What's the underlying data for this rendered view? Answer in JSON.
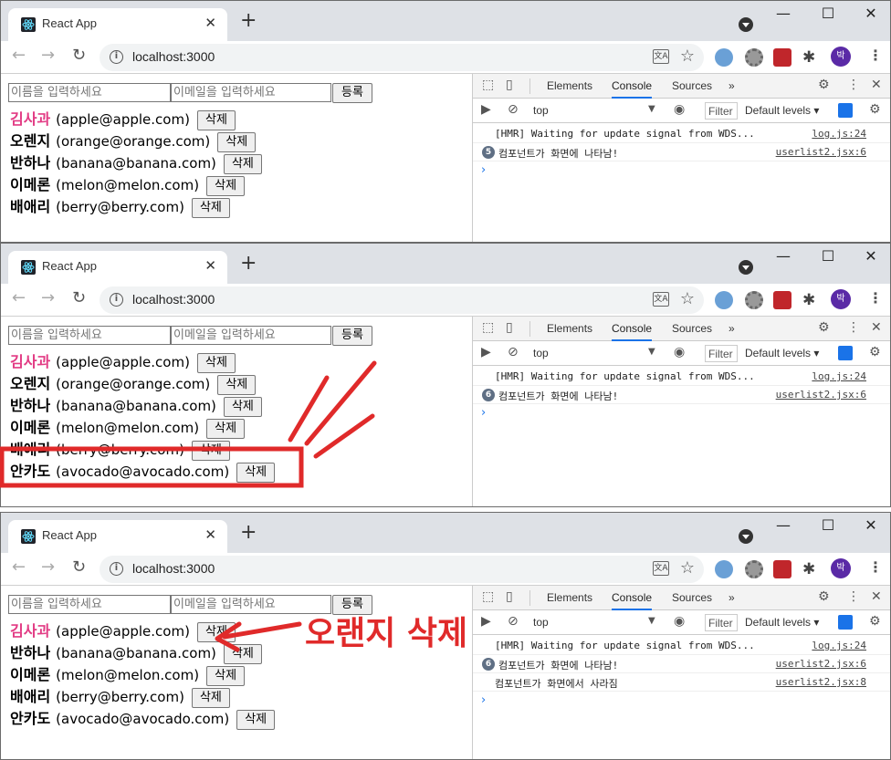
{
  "browser": {
    "tab_title": "React App",
    "tab_close": "✕",
    "new_tab": "+",
    "minimize": "—",
    "maximize": "☐",
    "close": "✕",
    "url": "localhost:3000",
    "translate_icon": "文A",
    "avatar": "박"
  },
  "form": {
    "name_placeholder": "이름을 입력하세요",
    "email_placeholder": "이메일을 입력하세요",
    "register_label": "등록"
  },
  "delete_label": "삭제",
  "panels": [
    {
      "users": [
        {
          "name": "김사과",
          "email": "(apple@apple.com)",
          "active": true
        },
        {
          "name": "오렌지",
          "email": "(orange@orange.com)",
          "active": false
        },
        {
          "name": "반하나",
          "email": "(banana@banana.com)",
          "active": false
        },
        {
          "name": "이메론",
          "email": "(melon@melon.com)",
          "active": false
        },
        {
          "name": "배애리",
          "email": "(berry@berry.com)",
          "active": false
        }
      ],
      "console": [
        {
          "count": "",
          "text": "[HMR] Waiting for update signal from WDS...",
          "source": "log.js:24"
        },
        {
          "count": "5",
          "text": "컴포넌트가 화면에 나타남!",
          "source": "userlist2.jsx:6"
        }
      ]
    },
    {
      "users": [
        {
          "name": "김사과",
          "email": "(apple@apple.com)",
          "active": true
        },
        {
          "name": "오렌지",
          "email": "(orange@orange.com)",
          "active": false
        },
        {
          "name": "반하나",
          "email": "(banana@banana.com)",
          "active": false
        },
        {
          "name": "이메론",
          "email": "(melon@melon.com)",
          "active": false
        },
        {
          "name": "배애리",
          "email": "(berry@berry.com)",
          "active": false
        },
        {
          "name": "안카도",
          "email": "(avocado@avocado.com)",
          "active": false
        }
      ],
      "console": [
        {
          "count": "",
          "text": "[HMR] Waiting for update signal from WDS...",
          "source": "log.js:24"
        },
        {
          "count": "6",
          "text": "컴포넌트가 화면에 나타남!",
          "source": "userlist2.jsx:6"
        }
      ]
    },
    {
      "users": [
        {
          "name": "김사과",
          "email": "(apple@apple.com)",
          "active": true
        },
        {
          "name": "반하나",
          "email": "(banana@banana.com)",
          "active": false
        },
        {
          "name": "이메론",
          "email": "(melon@melon.com)",
          "active": false
        },
        {
          "name": "배애리",
          "email": "(berry@berry.com)",
          "active": false
        },
        {
          "name": "안카도",
          "email": "(avocado@avocado.com)",
          "active": false
        }
      ],
      "console": [
        {
          "count": "",
          "text": "[HMR] Waiting for update signal from WDS...",
          "source": "log.js:24"
        },
        {
          "count": "6",
          "text": "컴포넌트가 화면에 나타남!",
          "source": "userlist2.jsx:6"
        },
        {
          "count": "",
          "text": "컴포넌트가 화면에서 사라짐",
          "source": "userlist2.jsx:8"
        }
      ]
    }
  ],
  "devtools": {
    "tabs": [
      "Elements",
      "Console",
      "Sources"
    ],
    "more": "»",
    "context": "top",
    "filter": "Filter",
    "levels": "Default levels ▾",
    "prompt": "›"
  },
  "annotation": {
    "text": "오랜지 삭제",
    "color": "#e02a2a"
  },
  "colors": {
    "active_name": "#e23b84",
    "console_tab_underline": "#1a73e8"
  }
}
